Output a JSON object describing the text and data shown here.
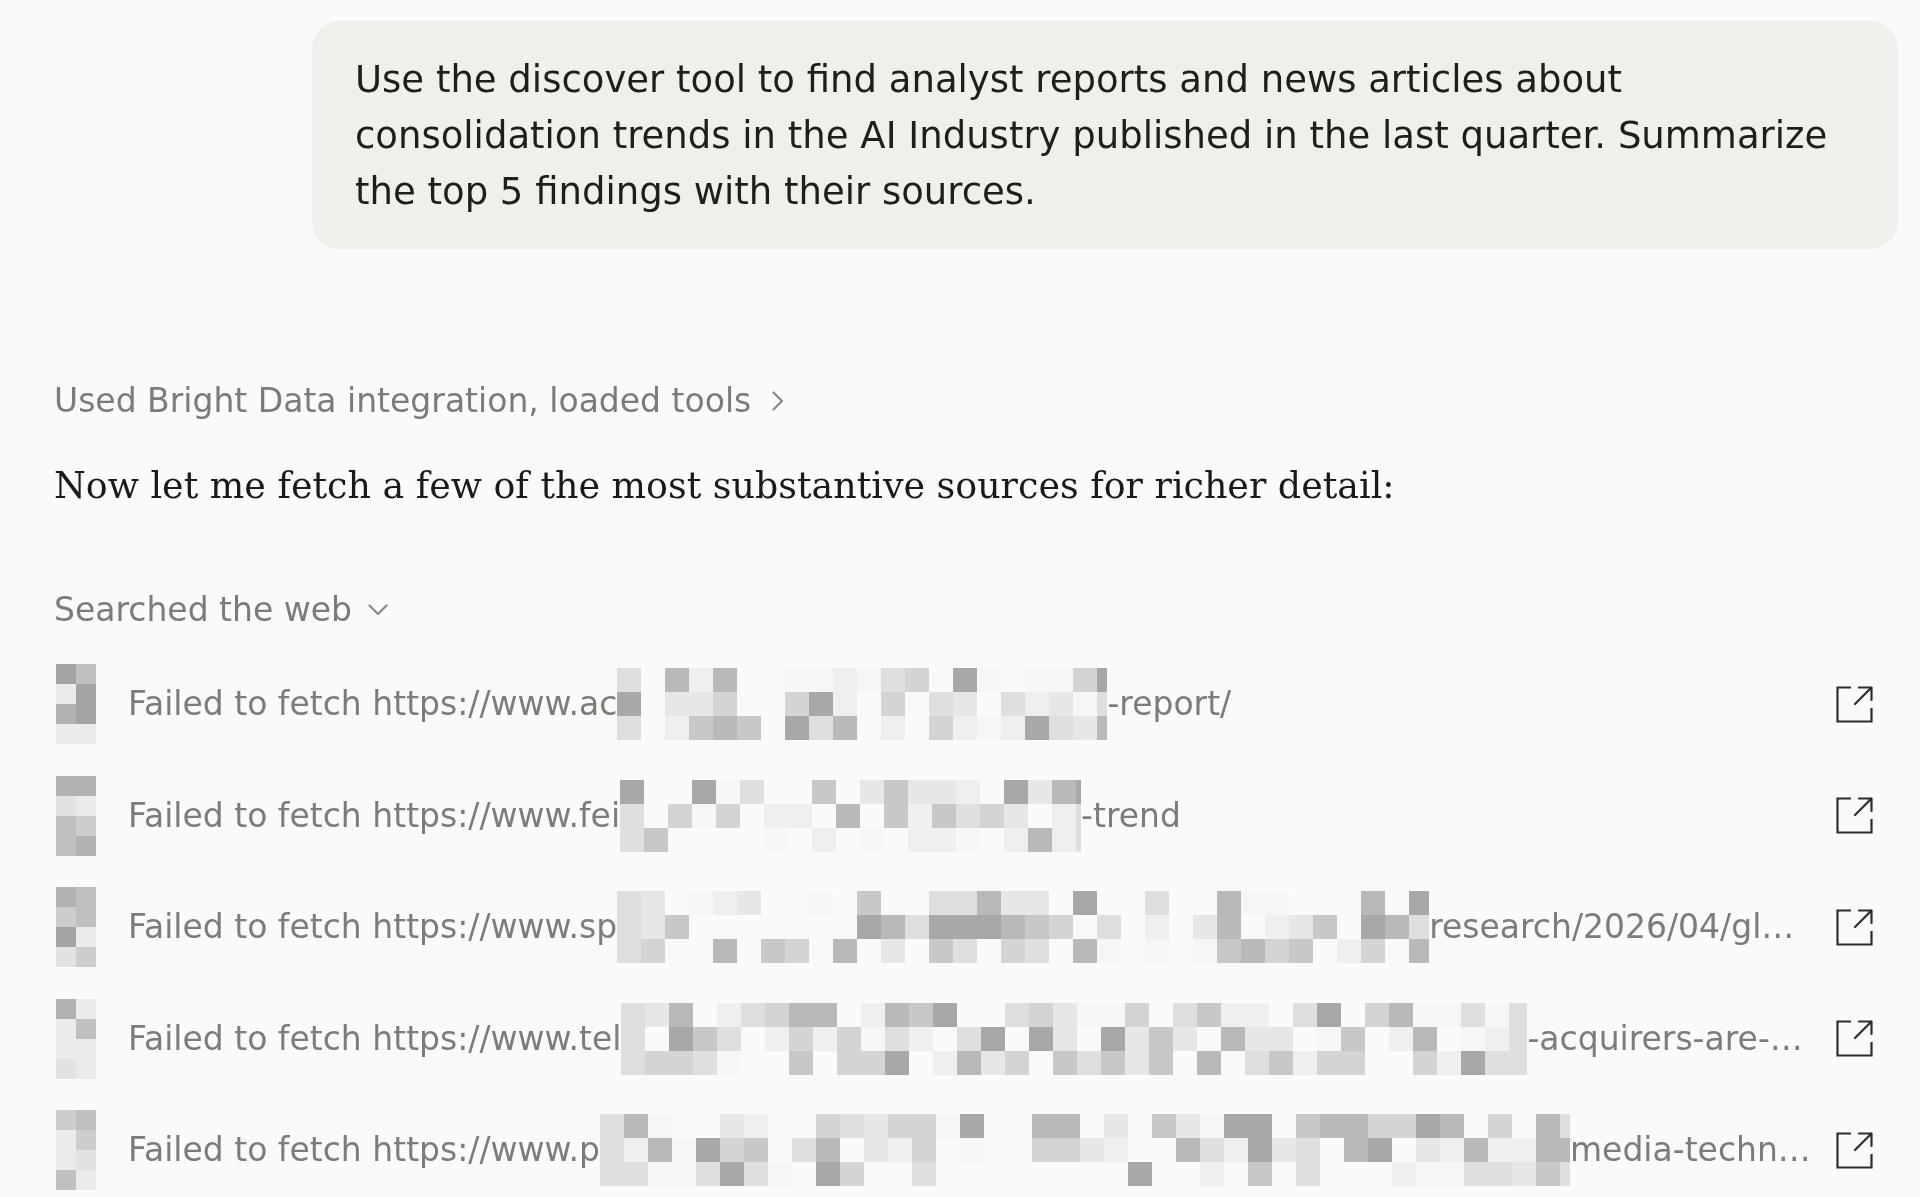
{
  "user_message": {
    "text": "Use the discover tool to find analyst reports and news articles about consolidation trends in the AI Industry published in the last quarter. Summarize the top 5 findings with their sources."
  },
  "tool_summary": {
    "label": "Used Bright Data integration, loaded tools",
    "expanded": false
  },
  "assistant_message": {
    "text": "Now let me fetch a few of the most substantive sources for richer detail:"
  },
  "web_search": {
    "label": "Searched the web",
    "expanded": true,
    "results": [
      {
        "text_before": "Failed to fetch https://www.ac",
        "text_after": "-report/"
      },
      {
        "text_before": "Failed to fetch https://www.fei",
        "text_after": "-trend"
      },
      {
        "text_before": "Failed to fetch https://www.sp",
        "text_after": "research/2026/04/gl…"
      },
      {
        "text_before": "Failed to fetch https://www.tel",
        "text_after": "-acquirers-are-…"
      },
      {
        "text_before": "Failed to fetch https://www.p",
        "text_after": "media-techn…"
      }
    ]
  }
}
